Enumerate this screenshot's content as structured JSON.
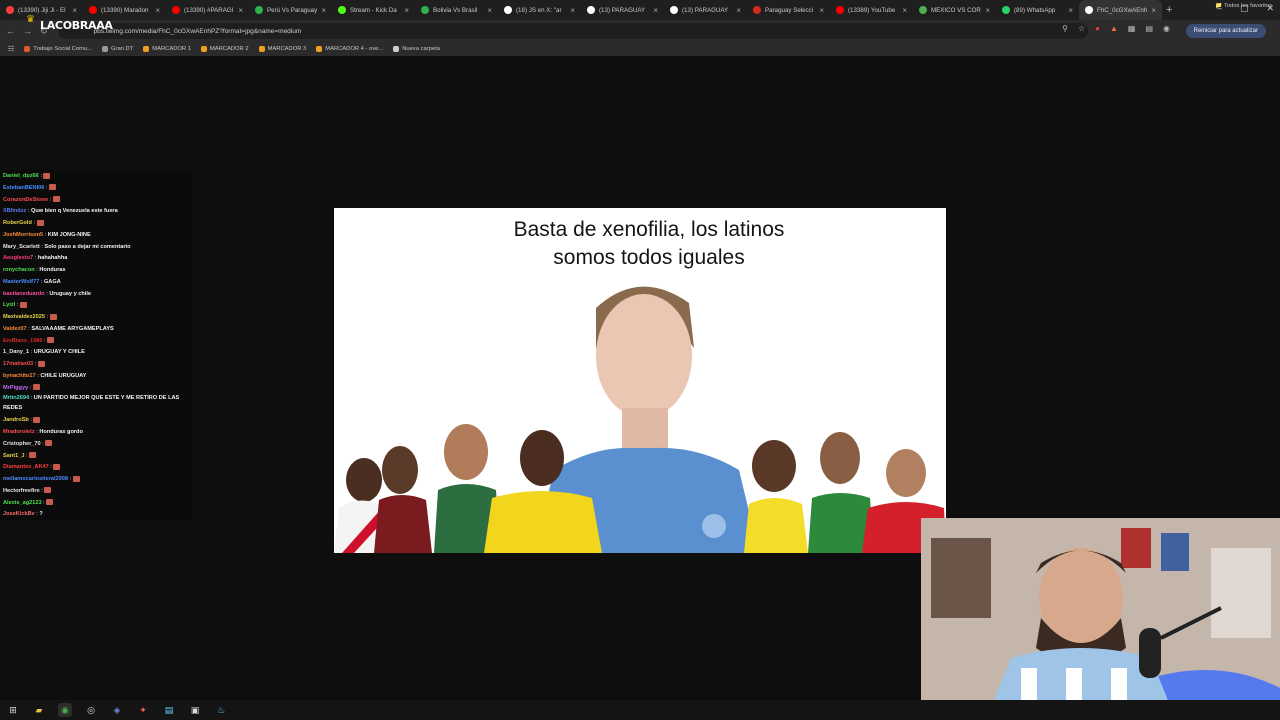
{
  "browser": {
    "tabs": [
      {
        "title": "(13390) Jiji Ji - El",
        "icon": "kick-icon",
        "color": "#ff3d3d"
      },
      {
        "title": "(13390) Maradon",
        "icon": "youtube-icon",
        "color": "#ff0000"
      },
      {
        "title": "(13390) #PARAGI",
        "icon": "youtube-icon",
        "color": "#ff0000"
      },
      {
        "title": "Perú Vs Paraguay",
        "icon": "green-icon",
        "color": "#2fb34a"
      },
      {
        "title": "Stream - Kick Da",
        "icon": "kick-icon",
        "color": "#53fc18"
      },
      {
        "title": "Bolivia Vs Brasil",
        "icon": "green-icon",
        "color": "#2fb34a"
      },
      {
        "title": "(18) JS en X: \"ar",
        "icon": "x-icon",
        "color": "#ffffff"
      },
      {
        "title": "(13) PARAGUAY",
        "icon": "x-icon",
        "color": "#ffffff"
      },
      {
        "title": "(13) PARAGUAY",
        "icon": "x-icon",
        "color": "#ffffff"
      },
      {
        "title": "Paraguay Selecci",
        "icon": "paraguay-icon",
        "color": "#d52b1e"
      },
      {
        "title": "(13389) YouTube",
        "icon": "youtube-icon",
        "color": "#ff0000"
      },
      {
        "title": "MEXICO VS COR",
        "icon": "chrome-icon",
        "color": "#4caf50"
      },
      {
        "title": "(89) WhatsApp",
        "icon": "whatsapp-icon",
        "color": "#25d366"
      },
      {
        "title": "FhC_0cGXwAEnh",
        "icon": "x-icon",
        "color": "#ffffff",
        "active": true
      }
    ],
    "new_tab": "+",
    "url": "pbs.twimg.com/media/FhC_0cGXwAEnhPZ?format=jpg&name=medium",
    "relaunch_label": "Reiniciar para actualizar",
    "bookmarks": [
      {
        "label": "Trabajo Social Comu...",
        "color": "#e05a2b"
      },
      {
        "label": "Gran DT",
        "color": "#999999"
      },
      {
        "label": "MARCADOR 1",
        "color": "#f0a020"
      },
      {
        "label": "MARCADOR 2",
        "color": "#f0a020"
      },
      {
        "label": "MARCADOR 3",
        "color": "#f0a020"
      },
      {
        "label": "MARCADOR 4 - ove...",
        "color": "#f0a020"
      },
      {
        "label": "Nueva carpeta",
        "color": "#cccccc"
      }
    ],
    "all_bookmarks": "Todos los favoritos"
  },
  "overlay": {
    "brand": "LACOBRAAA"
  },
  "chat": [
    {
      "user": "Daniel_dpz66",
      "color": "#4ee04e",
      "text": "",
      "emote": true
    },
    {
      "user": "EstebanBENI06",
      "color": "#4a8cff",
      "text": "",
      "emote": true
    },
    {
      "user": "CorazonDeStone",
      "color": "#ff4d4d",
      "text": "",
      "emote": true
    },
    {
      "user": "XBlindzz",
      "color": "#5b7cff",
      "text": "Quw bien q Venezuela este fuera",
      "emote": false
    },
    {
      "user": "RoberGold",
      "color": "#e8d24a",
      "text": "",
      "emote": true
    },
    {
      "user": "JoshMorrison5",
      "color": "#ff8c3a",
      "text": "KIM JONG-NINE",
      "emote": false
    },
    {
      "user": "Mary_Scarlett",
      "color": "#e6e6e6",
      "text": "Solo paso a dejar mi comentario",
      "emote": false
    },
    {
      "user": "Aeuglesto7",
      "color": "#ff3b7a",
      "text": "hahahahha",
      "emote": false
    },
    {
      "user": "ronychacon",
      "color": "#4ee04e",
      "text": "Honduras",
      "emote": false
    },
    {
      "user": "MasterWolf77",
      "color": "#4a8cff",
      "text": "GAGA",
      "emote": false
    },
    {
      "user": "bastianeduardo",
      "color": "#ff4da6",
      "text": "Uruguay y chile",
      "emote": false
    },
    {
      "user": "Lyizl",
      "color": "#4ee04e",
      "text": "",
      "emote": true
    },
    {
      "user": "Maxivaldez2025",
      "color": "#e8d24a",
      "text": "",
      "emote": true
    },
    {
      "user": "Valdez07",
      "color": "#ff8c3a",
      "text": "SALVAAAME ARYGAMEPLAYS",
      "emote": false
    },
    {
      "user": "EmBians_1986",
      "color": "#d42a2a",
      "text": "",
      "emote": true
    },
    {
      "user": "1_Dany_1",
      "color": "#e6e6e6",
      "text": "URUGUAY Y CHILE",
      "emote": false
    },
    {
      "user": "17matias03",
      "color": "#ff4d4d",
      "text": "",
      "emote": true
    },
    {
      "user": "bynachito17",
      "color": "#ff8c3a",
      "text": "CHILE URUGUAY",
      "emote": false
    },
    {
      "user": "MrPiggyy",
      "color": "#c86bff",
      "text": "",
      "emote": true
    },
    {
      "user": "Mrtin2694",
      "color": "#4ee0c8",
      "text": "UN PARTIDO MEJOR QUE ESTE Y ME RETIRO DE LAS REDES",
      "emote": false,
      "wrap": true
    },
    {
      "user": "JandroSb",
      "color": "#e8d24a",
      "text": "",
      "emote": true
    },
    {
      "user": "Mradoroletz",
      "color": "#ff4d4d",
      "text": "Honduras gordo",
      "emote": false
    },
    {
      "user": "Cristopher_70",
      "color": "#e6e6e6",
      "text": "",
      "emote": true
    },
    {
      "user": "Sant1_J",
      "color": "#e8d24a",
      "text": "",
      "emote": true
    },
    {
      "user": "Diamantes_AK47",
      "color": "#ff3b3b",
      "text": "",
      "emote": true
    },
    {
      "user": "mellamocarlositeral2008",
      "color": "#4a8cff",
      "text": "",
      "emote": true
    },
    {
      "user": "Hectorfreefire",
      "color": "#e6e6e6",
      "text": "",
      "emote": true
    },
    {
      "user": "Alexis_ag2123",
      "color": "#4ee04e",
      "text": "",
      "emote": true
    },
    {
      "user": "JoseKickBv",
      "color": "#ff6b6b",
      "text": "?",
      "emote": false
    }
  ],
  "meme": {
    "title_line1": "Basta de xenofilia, los latinos",
    "title_line2": "somos todos iguales"
  },
  "taskbar": {
    "icons": [
      "windows-start-icon",
      "file-explorer-icon",
      "chrome-icon",
      "obs-icon",
      "discord-icon",
      "app-icon",
      "notepad-icon",
      "taskview-icon",
      "steam-icon"
    ]
  }
}
